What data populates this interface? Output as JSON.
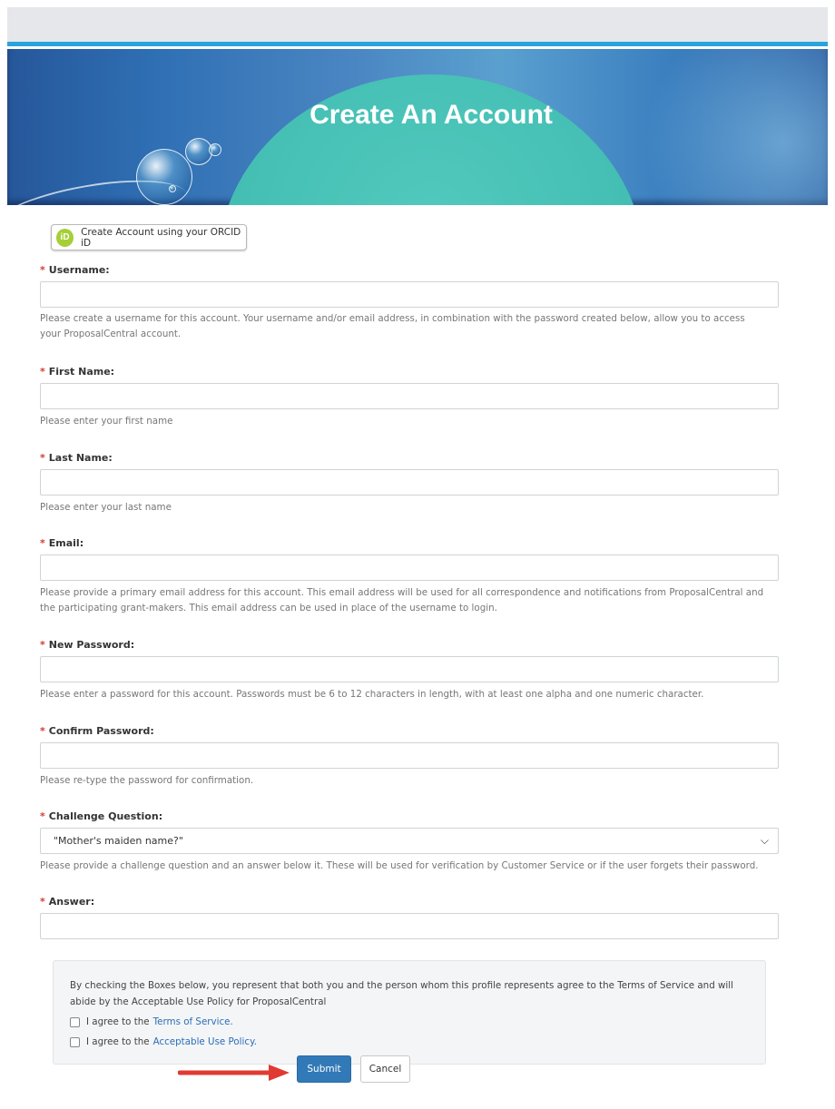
{
  "banner": {
    "title": "Create An Account"
  },
  "orcid": {
    "label": "Create Account using your ORCID iD",
    "icon": "orcid-icon",
    "icon_text": "iD"
  },
  "required_marker": "*",
  "fields": {
    "username": {
      "label": "Username:",
      "value": "",
      "help": "Please create a username for this account. Your username and/or email address, in combination with the password created below, allow you to access your ProposalCentral account."
    },
    "first_name": {
      "label": "First Name:",
      "value": "",
      "help": "Please enter your first name"
    },
    "last_name": {
      "label": "Last Name:",
      "value": "",
      "help": "Please enter your last name"
    },
    "email": {
      "label": "Email:",
      "value": "",
      "help": "Please provide a primary email address for this account. This email address will be used for all correspondence and notifications from ProposalCentral and the participating grant-makers. This email address can be used in place of the username to login."
    },
    "new_password": {
      "label": "New Password:",
      "value": "",
      "help": "Please enter a password for this account. Passwords must be 6 to 12 characters in length, with at least one alpha and one numeric character."
    },
    "confirm_password": {
      "label": "Confirm Password:",
      "value": "",
      "help": "Please re-type the password for confirmation."
    },
    "challenge_question": {
      "label": "Challenge Question:",
      "selected": "\"Mother's maiden name?\"",
      "help": "Please provide a challenge question and an answer below it. These will be used for verification by Customer Service or if the user forgets their password."
    },
    "answer": {
      "label": "Answer:",
      "value": ""
    }
  },
  "terms": {
    "intro": "By checking the Boxes below, you represent that both you and the person whom this profile represents agree to the Terms of Service and will abide by the Acceptable Use Policy for ProposalCentral",
    "tos_prefix": "I agree to the",
    "tos_link": "Terms of Service.",
    "aup_prefix": "I agree to the",
    "aup_link": "Acceptable Use Policy."
  },
  "actions": {
    "submit": "Submit",
    "cancel": "Cancel"
  },
  "colors": {
    "primary": "#3279b7",
    "required": "#d43b34",
    "annotation_arrow": "#e03a32",
    "orcid": "#a6ce39"
  }
}
